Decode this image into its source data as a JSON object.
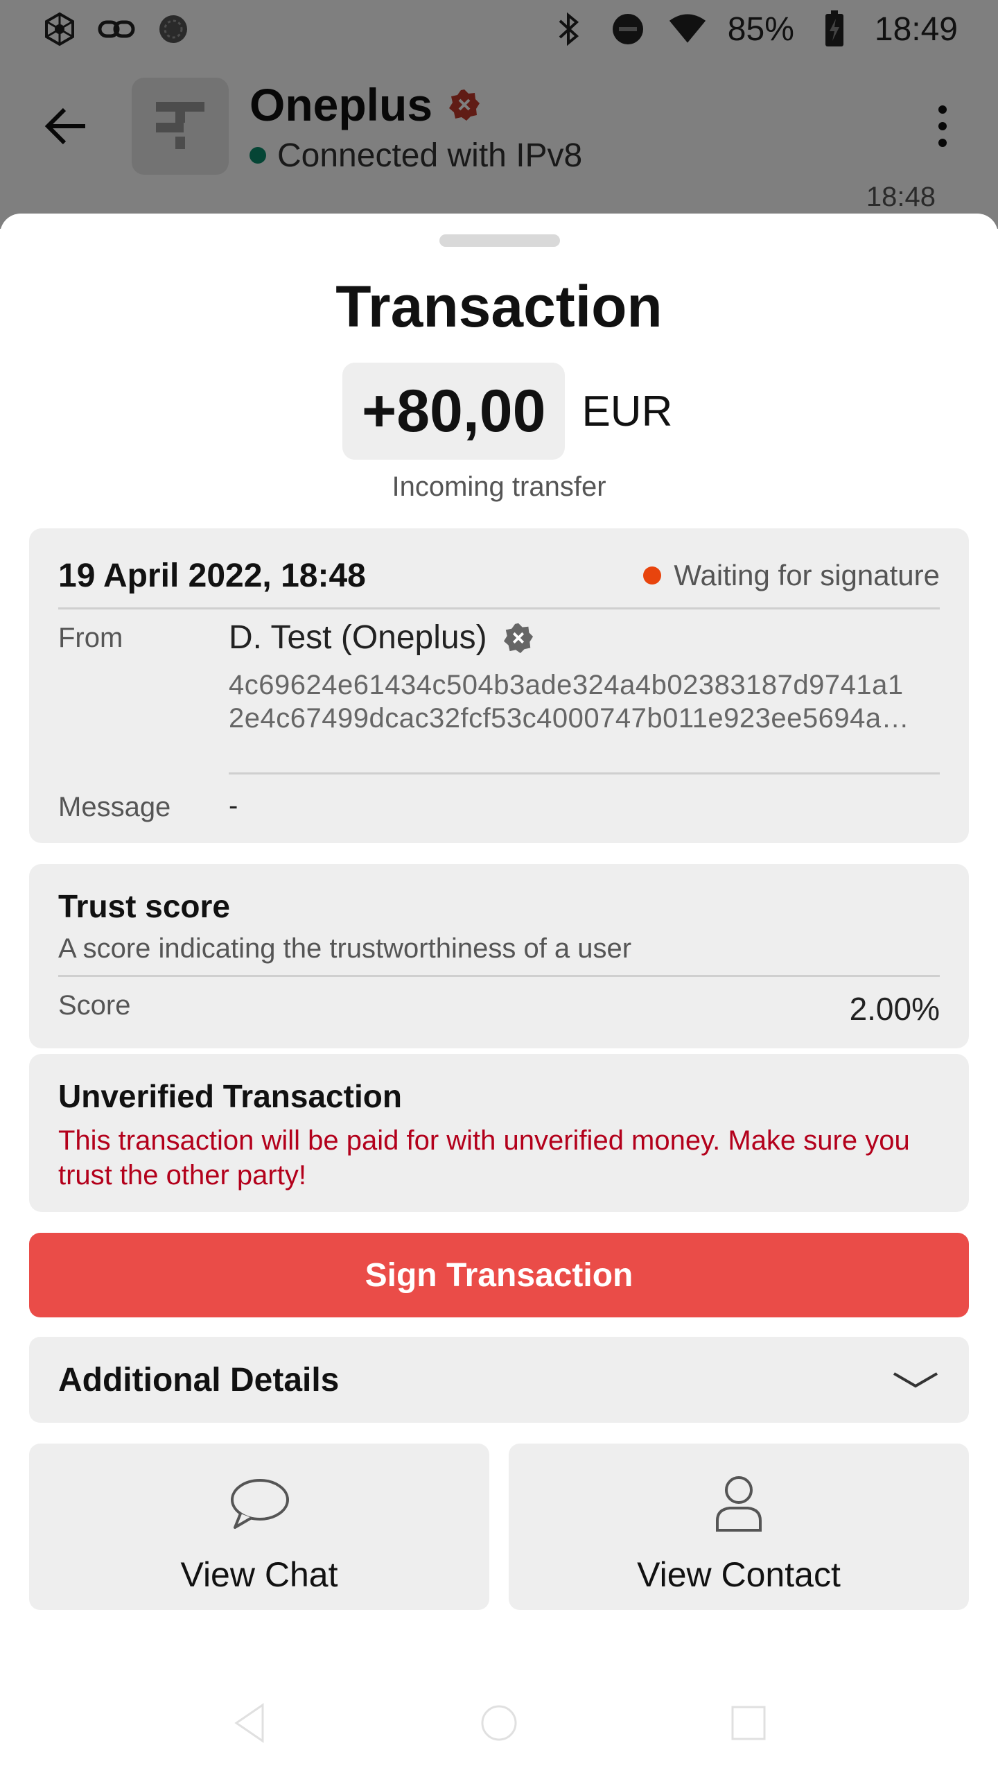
{
  "status_bar": {
    "battery": "85%",
    "time": "18:49"
  },
  "app_bar": {
    "title": "Oneplus",
    "connection": "Connected with IPv8"
  },
  "background_peek": "18:48",
  "sheet": {
    "title": "Transaction",
    "amount": "+80,00",
    "currency": "EUR",
    "transfer_type": "Incoming transfer",
    "details": {
      "date": "19 April 2022, 18:48",
      "status": "Waiting for signature",
      "from_label": "From",
      "from_name": "D. Test (Oneplus)",
      "from_key_line1": "4c69624e61434c504b3ade324a4b02383187d9741a1",
      "from_key_line2": "2e4c67499dcac32fcf53c4000747b011e923ee5694a…",
      "message_label": "Message",
      "message_value": "-"
    },
    "trust": {
      "title": "Trust score",
      "description": "A score indicating the trustworthiness of a user",
      "score_label": "Score",
      "score_value": "2.00%"
    },
    "unverified": {
      "title": "Unverified Transaction",
      "warning": "This transaction will be paid for with unverified money. Make sure you trust the other party!"
    },
    "sign_button": "Sign Transaction",
    "additional_details": "Additional Details",
    "actions": {
      "chat": "View Chat",
      "contact": "View Contact"
    }
  },
  "colors": {
    "accent_red": "#ea4c48",
    "warning_red": "#b3001b",
    "status_orange": "#e8440d",
    "connected_green": "#0a8a6a",
    "card_bg": "#eeeeee"
  }
}
